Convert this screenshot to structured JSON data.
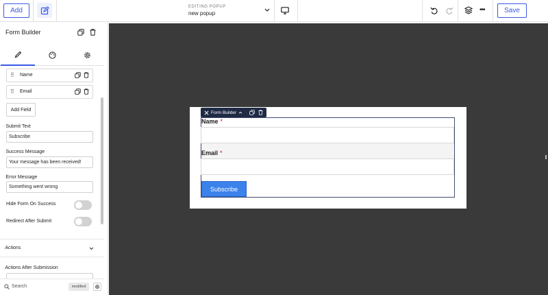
{
  "topbar": {
    "add_label": "Add",
    "editing_label": "EDITING POPUP",
    "popup_name": "new popup",
    "save_label": "Save",
    "accent_color": "#3858e9"
  },
  "sidebar": {
    "title": "Form Builder",
    "tabs": [
      "pencil-icon",
      "palette-icon",
      "gear-icon"
    ],
    "fields": [
      {
        "label": "Name"
      },
      {
        "label": "Email"
      }
    ],
    "add_field_label": "Add Field",
    "submit_text_label": "Submit Text",
    "submit_text_value": "Subscribe",
    "success_message_label": "Success Message",
    "success_message_value": "Your message has been received!",
    "error_message_label": "Error Message",
    "error_message_value": "Something went wrong",
    "hide_form_label": "Hide Form On Success",
    "redirect_label": "Redirect After Submit",
    "actions_title": "Actions",
    "actions_after_label": "Actions After Submission",
    "search_placeholder": "Search",
    "modified_badge": "modified"
  },
  "canvas": {
    "background": "#3a3a3a",
    "block_toolbar_label": "Form Builder",
    "form": {
      "fields": [
        {
          "label": "Name",
          "required_mark": "*"
        },
        {
          "label": "Email",
          "required_mark": "*"
        }
      ],
      "submit_label": "Subscribe",
      "button_color": "#3b82ea"
    }
  }
}
